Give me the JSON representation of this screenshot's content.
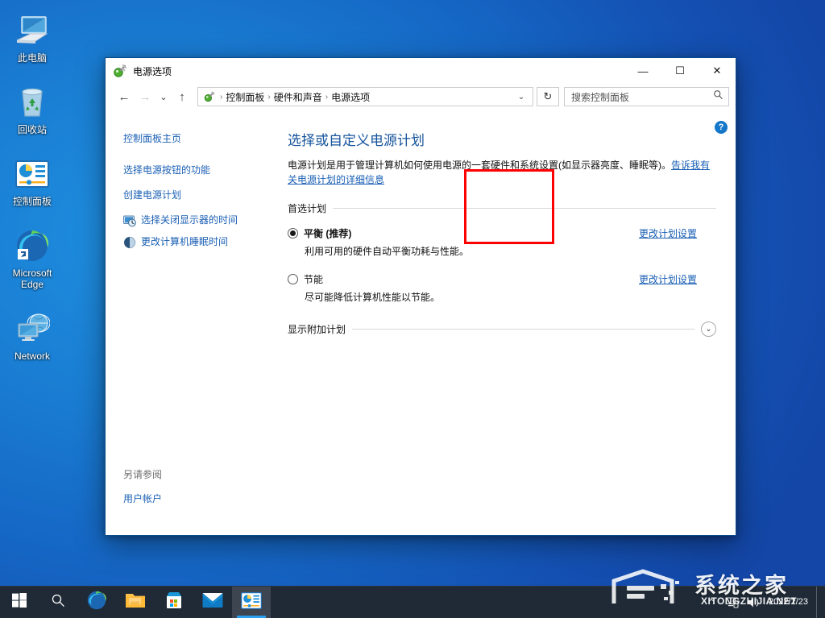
{
  "desktop": {
    "icons": [
      {
        "name": "this-pc",
        "label": "此电脑",
        "icon": "computer-icon"
      },
      {
        "name": "recycle-bin",
        "label": "回收站",
        "icon": "recycle-bin-icon"
      },
      {
        "name": "control-panel",
        "label": "控制面板",
        "icon": "control-panel-icon"
      },
      {
        "name": "microsoft-edge",
        "label": "Microsoft Edge",
        "icon": "edge-icon"
      },
      {
        "name": "network",
        "label": "Network",
        "icon": "network-icon"
      }
    ],
    "wallpaper_color": "#1566c4"
  },
  "window": {
    "title": "电源选项",
    "icon": "power-options-icon",
    "controls": {
      "minimize": "—",
      "maximize": "☐",
      "close": "✕",
      "minimize_name": "minimize",
      "maximize_name": "maximize",
      "close_name": "close"
    },
    "nav": {
      "back": "←",
      "forward": "→",
      "recent": "⌄",
      "up": "↑",
      "refresh": "↻",
      "dropdown": "⌄"
    },
    "breadcrumb": {
      "separator": "›",
      "items": [
        "控制面板",
        "硬件和声音",
        "电源选项"
      ]
    },
    "search": {
      "placeholder": "搜索控制面板",
      "value": "",
      "icon": "search-icon"
    }
  },
  "sidebar": {
    "home_link": "控制面板主页",
    "links": [
      {
        "label": "选择电源按钮的功能",
        "icon": null
      },
      {
        "label": "创建电源计划",
        "icon": null
      },
      {
        "label": "选择关闭显示器的时间",
        "icon": "clock-display-icon"
      },
      {
        "label": "更改计算机睡眠时间",
        "icon": "sleep-icon"
      }
    ],
    "see_also_header": "另请参阅",
    "see_also_links": [
      "用户帐户"
    ]
  },
  "content": {
    "help_button": "?",
    "title": "选择或自定义电源计划",
    "description_prefix": "电源计划是用于管理计算机如何使用电源的一套硬件和系统设置(如显示器亮度、睡眠等)。",
    "description_link": "告诉我有关电源计划的详细信息",
    "preferred_plans_label": "首选计划",
    "plans": [
      {
        "name": "平衡 (推荐)",
        "description": "利用可用的硬件自动平衡功耗与性能。",
        "selected": true,
        "action_label": "更改计划设置"
      },
      {
        "name": "节能",
        "description": "尽可能降低计算机性能以节能。",
        "selected": false,
        "action_label": "更改计划设置"
      }
    ],
    "show_additional_label": "显示附加计划",
    "expand_icon": "chevron-down-icon",
    "highlight_color": "#ff0000"
  },
  "taskbar": {
    "items": [
      {
        "name": "start",
        "icon": "windows-logo-icon",
        "active": false
      },
      {
        "name": "search",
        "icon": "search-icon",
        "active": false
      },
      {
        "name": "edge",
        "icon": "edge-icon",
        "active": false
      },
      {
        "name": "file-explorer",
        "icon": "folder-icon",
        "active": false
      },
      {
        "name": "store",
        "icon": "store-icon",
        "active": false
      },
      {
        "name": "mail",
        "icon": "mail-icon",
        "active": false
      },
      {
        "name": "control-panel",
        "icon": "control-panel-icon",
        "active": true
      }
    ],
    "tray": {
      "show_hidden": "⌃",
      "network": "network-icon",
      "volume": "volume-icon"
    },
    "clock": {
      "time": "2022/2/23",
      "date": ""
    }
  },
  "watermark": {
    "chinese": "系统之家",
    "english": "XITONGZHIJIA.NET"
  }
}
